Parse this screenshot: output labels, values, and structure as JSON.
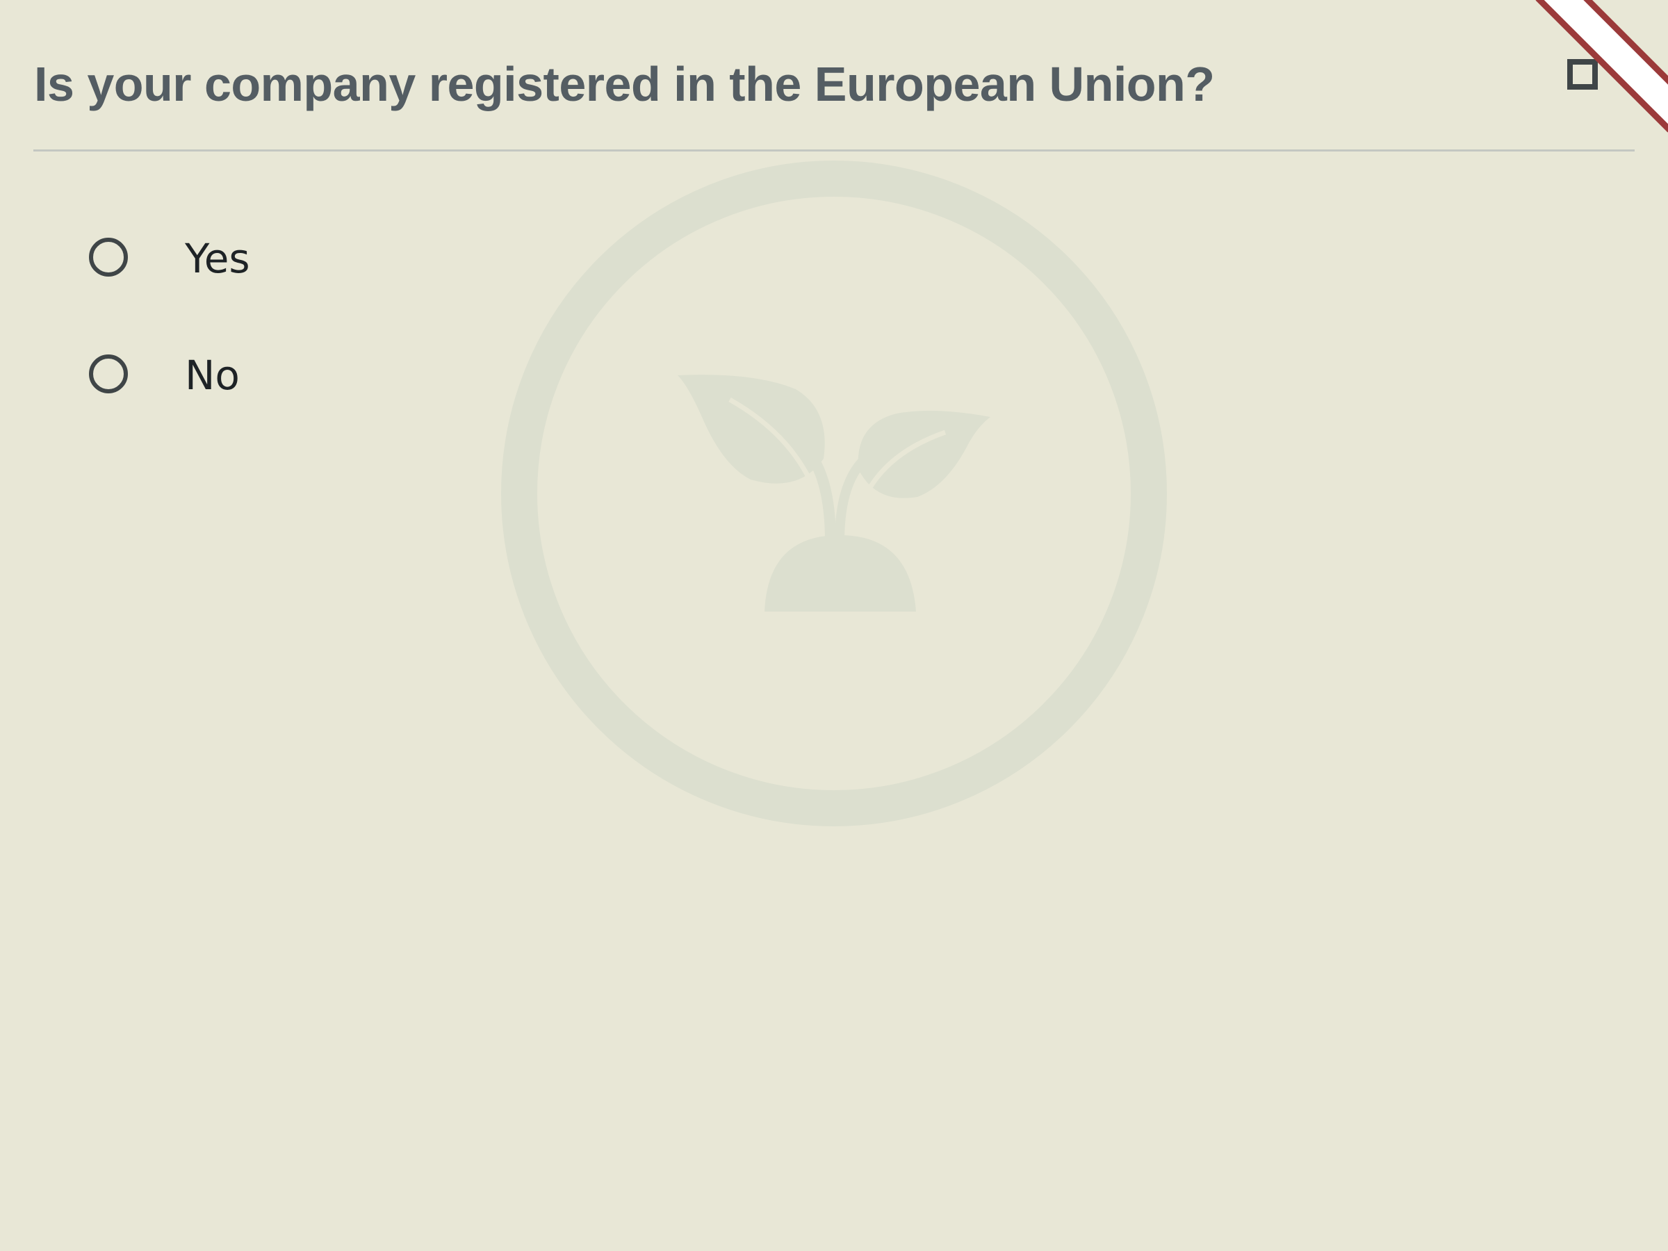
{
  "question": {
    "title": "Is your company registered in the European Union?"
  },
  "options": [
    {
      "label": "Yes",
      "selected": false
    },
    {
      "label": "No",
      "selected": false
    }
  ],
  "flag": {
    "checked": false
  },
  "colors": {
    "background": "#e8e7d6",
    "title": "#545d63",
    "option_text": "#1e2326",
    "radio_border": "#3f4547",
    "divider": "#c4c7c2",
    "watermark": "#dcdfcf",
    "ribbon_red": "#9b3a3a",
    "ribbon_white": "#ffffff"
  },
  "icons": {
    "watermark": "sprout-in-circle-icon",
    "corner": "corner-ribbon",
    "flag": "checkbox-icon"
  }
}
